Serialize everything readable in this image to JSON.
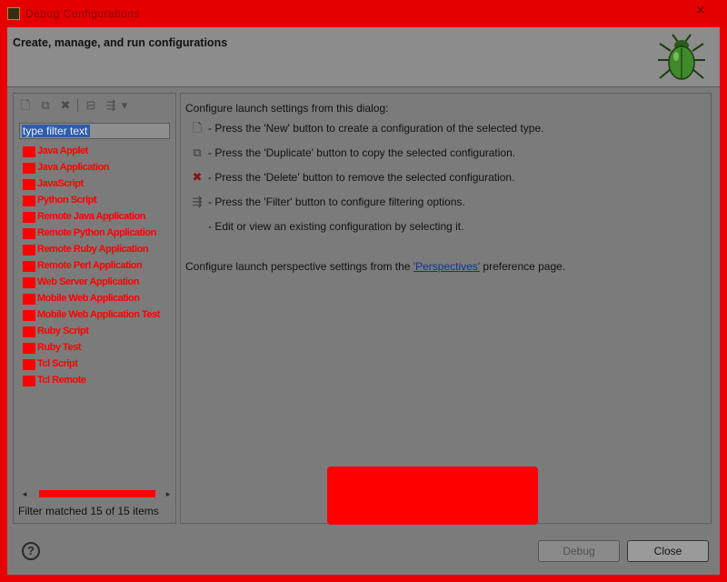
{
  "window": {
    "title": "Debug Configurations",
    "close_glyph": "✕"
  },
  "banner": {
    "title": "Create, manage, and run configurations",
    "icon": "bug-icon"
  },
  "left": {
    "toolbar": [
      {
        "icon": "new-config-icon",
        "glyph": "🗋"
      },
      {
        "icon": "duplicate-icon",
        "glyph": "⧉"
      },
      {
        "icon": "delete-icon",
        "glyph": "✖"
      },
      {
        "icon": "collapse-all-icon",
        "glyph": "⊟"
      },
      {
        "icon": "filter-icon",
        "glyph": "⇶"
      },
      {
        "icon": "dropdown-arrow-icon",
        "glyph": "▾"
      }
    ],
    "filter_value": "type filter text",
    "tree_items": [
      "Java Applet",
      "Java Application",
      "JavaScript",
      "Python Script",
      "Remote Java Application",
      "Remote Python Application",
      "Remote Ruby Application",
      "Remote Perl Application",
      "Web Server Application",
      "Mobile Web Application",
      "Mobile Web Application Test",
      "Ruby Script",
      "Ruby Test",
      "Tcl Script",
      "Tcl Remote"
    ],
    "filter_status": "Filter matched 15 of 15 items",
    "scroll_left": "◂",
    "scroll_right": "▸"
  },
  "right": {
    "intro": "Configure launch settings from this dialog:",
    "lines": [
      {
        "icon": "new-icon",
        "glyph": "🗋",
        "text": "- Press the 'New' button to create a configuration of the selected type."
      },
      {
        "icon": "duplicate-icon",
        "glyph": "⧉",
        "text": "- Press the 'Duplicate' button to copy the selected configuration."
      },
      {
        "icon": "delete-icon",
        "glyph": "✖",
        "text": "- Press the 'Delete' button to remove the selected configuration."
      },
      {
        "icon": "filter-icon",
        "glyph": "⇶",
        "text": "- Press the 'Filter' button to configure filtering options."
      },
      {
        "icon": "",
        "glyph": "",
        "text": "- Edit or view an existing configuration by selecting it."
      }
    ],
    "perspective_prefix": "Configure launch perspective settings from the ",
    "perspective_link": "'Perspectives'",
    "perspective_suffix": " preference page."
  },
  "footer": {
    "help_glyph": "?",
    "debug_label": "Debug",
    "close_label": "Close"
  },
  "colors": {
    "redaction": "#ff0000",
    "link": "#0a3a8a",
    "selection": "#2f5da8"
  }
}
